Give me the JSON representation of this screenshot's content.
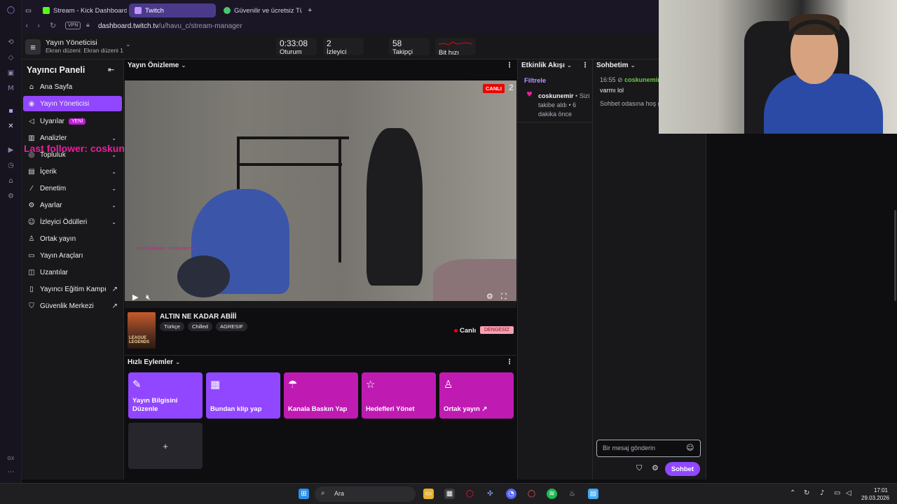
{
  "browser": {
    "tabs": [
      {
        "label": "Stream - Kick Dashboard",
        "favicon_color": "#53fc18"
      },
      {
        "label": "Twitch",
        "favicon_color": "#bf94ff"
      },
      {
        "label": "Güvenilir ve ücretsiz Türkç",
        "favicon_color": "#48c76c"
      }
    ],
    "new_tab": "+",
    "vpn_label": "VPN",
    "url_domain": "dashboard.twitch.tv",
    "url_path": "/u/havu_c/stream-manager"
  },
  "header": {
    "title": "Yayın Yöneticisi",
    "subtitle": "Ekran düzeni: Ekran düzeni 1",
    "stats": [
      {
        "value": "0:33:08",
        "label": "Oturum"
      },
      {
        "value": "2",
        "label": "İzleyici"
      },
      {
        "value": "58",
        "label": "Takipçi"
      },
      {
        "value": "",
        "label": "Bit hızı"
      }
    ]
  },
  "sidebar": {
    "title": "Yayıncı Paneli",
    "items": [
      {
        "label": "Ana Sayfa",
        "icon": "home-icon"
      },
      {
        "label": "Yayın Yöneticisi",
        "icon": "broadcast-icon",
        "active": true
      },
      {
        "label": "Uyarılar",
        "icon": "megaphone-icon",
        "badge": "YENİ"
      },
      {
        "label": "Analizler",
        "icon": "chart-icon"
      },
      {
        "label": "Topluluk",
        "icon": "community-icon"
      },
      {
        "label": "İçerik",
        "icon": "content-icon"
      },
      {
        "label": "Denetim",
        "icon": "sword-icon"
      },
      {
        "label": "Ayarlar",
        "icon": "gear-icon"
      },
      {
        "label": "İzleyici Ödülleri",
        "icon": "reward-icon"
      },
      {
        "label": "Ortak yayın",
        "icon": "person-add-icon"
      },
      {
        "label": "Yayın Araçları",
        "icon": "tools-icon"
      },
      {
        "label": "Uzantılar",
        "icon": "extension-icon"
      },
      {
        "label": "Yayıncı Eğitim Kampı",
        "icon": "book-icon"
      },
      {
        "label": "Güvenlik Merkezi",
        "icon": "shield-icon"
      }
    ],
    "overlay_text": "Last follower: coskunemir"
  },
  "preview": {
    "heading": "Yayın Önizleme",
    "live_badge": "CANLI",
    "live_count": "2",
    "video_overlay": "Last follower: coskunemir",
    "stream_title": "ALTIN NE KADAR ABİİİ",
    "tags": [
      "Türkçe",
      "Chilled",
      "AGRESIF"
    ],
    "category_cover": "LEAGUE LEGENDS",
    "status": "Canlı",
    "status_badge": "DENGESİZ"
  },
  "quick_actions": {
    "heading": "Hızlı Eylemler",
    "tiles": [
      {
        "label": "Yayın Bilgisini Düzenle",
        "icon": "pencil-icon",
        "color": "#9147ff"
      },
      {
        "label": "Bundan klip yap",
        "icon": "clapper-icon",
        "color": "#9147ff"
      },
      {
        "label": "Kanala Baskın Yap",
        "icon": "parachute-icon",
        "color": "#bf1bb3"
      },
      {
        "label": "Hedefleri Yönet",
        "icon": "star-icon",
        "color": "#bf1bb3"
      },
      {
        "label": "Ortak yayın ↗",
        "icon": "person-add-icon",
        "color": "#bf1bb3"
      }
    ],
    "add_label": "+"
  },
  "activity": {
    "heading": "Etkinlik Akışı",
    "filter": "Filtrele",
    "event_user": "coskunemir",
    "event_text": "• Sizi takibe aldı • 6 dakika önce"
  },
  "chat": {
    "heading": "Sohbetim",
    "time": "16:55",
    "user": "coskunemir",
    "message": "varmı lol",
    "welcome": "Sohbet odasına hoş geldiniz!",
    "placeholder": "Bir mesaj gönderin",
    "send": "Sohbet"
  },
  "taskbar": {
    "search": "Ara",
    "time": "17:01",
    "date": "29.03.2026"
  },
  "colors": {
    "twitch_purple": "#9147ff",
    "magenta": "#bf1bb3",
    "live_red": "#eb0400"
  }
}
